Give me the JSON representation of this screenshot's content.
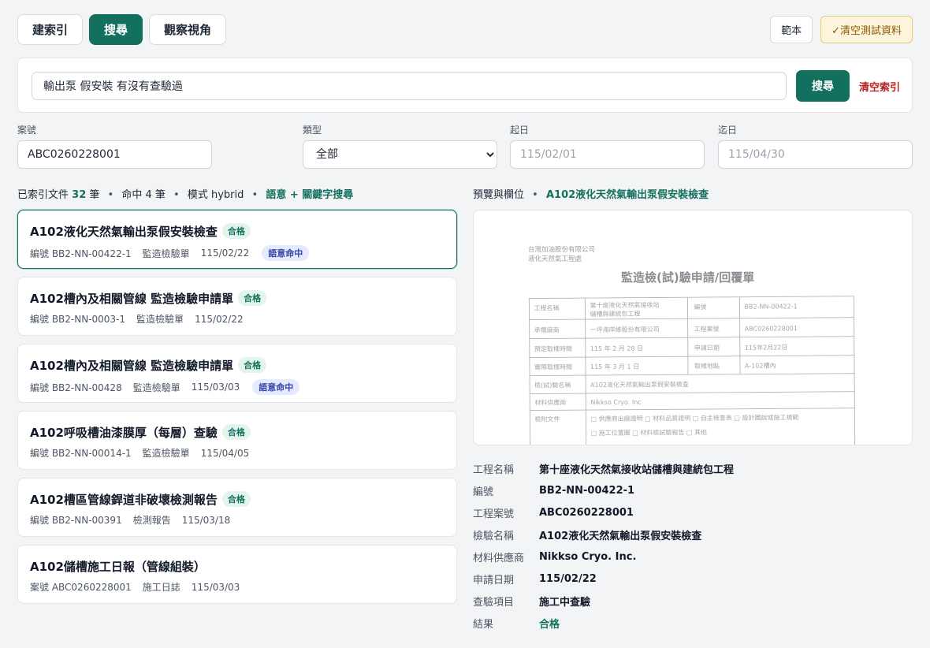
{
  "tabs": [
    {
      "label": "建索引"
    },
    {
      "label": "搜尋"
    },
    {
      "label": "觀察視角"
    }
  ],
  "top_buttons": {
    "sample": "範本",
    "clear_test": "✓清空測試資料"
  },
  "search": {
    "query": "輸出泵 假安裝 有沒有查驗過",
    "button": "搜尋",
    "clear_index": "清空索引"
  },
  "filters": {
    "case_no": {
      "label": "案號",
      "value": "ABC0260228001"
    },
    "type": {
      "label": "類型",
      "selected": "全部"
    },
    "start": {
      "label": "起日",
      "placeholder": "115/02/01"
    },
    "end": {
      "label": "迄日",
      "placeholder": "115/04/30"
    }
  },
  "summary": {
    "indexed_prefix": "已索引文件",
    "indexed_count": "32",
    "indexed_suffix": "筆",
    "dot": "•",
    "hits": "命中 4 筆",
    "mode": "模式 hybrid",
    "mode_label": "語意 + 關鍵字搜尋"
  },
  "results": [
    {
      "title": "A102液化天然氣輸出泵假安裝檢查",
      "badge": "合格",
      "id": "編號 BB2-NN-00422-1",
      "type": "監造檢驗單",
      "date": "115/02/22",
      "semantic": "語意命中"
    },
    {
      "title": "A102槽內及相關管線 監造檢驗申請單",
      "badge": "合格",
      "id": "編號 BB2-NN-0003-1",
      "type": "監造檢驗單",
      "date": "115/02/22",
      "semantic": ""
    },
    {
      "title": "A102槽內及相關管線 監造檢驗申請單",
      "badge": "合格",
      "id": "編號 BB2-NN-00428",
      "type": "監造檢驗單",
      "date": "115/03/03",
      "semantic": "語意命中"
    },
    {
      "title": "A102呼吸槽油漆膜厚（每層）查驗",
      "badge": "合格",
      "id": "編號 BB2-NN-00014-1",
      "type": "監造檢驗單",
      "date": "115/04/05",
      "semantic": ""
    },
    {
      "title": "A102槽區管線銲道非破壞檢測報告",
      "badge": "合格",
      "id": "編號 BB2-NN-00391",
      "type": "檢測報告",
      "date": "115/03/18",
      "semantic": ""
    },
    {
      "title": "A102儲槽施工日報（管線組裝）",
      "badge": "",
      "id": "案號 ABC0260228001",
      "type": "施工日誌",
      "date": "115/03/03",
      "semantic": ""
    }
  ],
  "preview": {
    "label": "預覽與欄位",
    "title": "A102液化天然氣輸出泵假安裝檢查",
    "doc": {
      "company_1": "台灣加油股份有限公司",
      "company_2": "液化天然氣工程處",
      "title": "監造檢(試)驗申請/回覆單",
      "rows": [
        [
          "工程名稱",
          "第十座液化天然氣接收站",
          "編號",
          "BB2-NN-00422-1"
        ],
        [
          "承攬廠商",
          "一坪海岸維股份有限公司",
          "工程案號",
          "ABC0260228001"
        ],
        [
          "預定取樣時間",
          "115 年 2 月 28 日",
          "申請日期",
          "115年2月22日"
        ],
        [
          "實際取樣時間",
          "115 年 3 月 1 日",
          "取樣地點",
          "A-102槽內"
        ],
        [
          "檢(試)驗名稱",
          "A102液化天然氣輸出泵假安裝檢查",
          "",
          ""
        ],
        [
          "材料供應商",
          "Nikkso Cryo. Inc",
          "",
          ""
        ],
        [
          "檢附文件",
          "□ 供應商出廠證明 □ 材料品質證明 □ 自主檢查表 □ 設計圖說或施工規範",
          "",
          ""
        ],
        [
          "",
          "□ 施工位置圖 □ 材料檢試驗報告 □ 其他",
          "",
          ""
        ]
      ],
      "row0_line2": "儲槽與建統包工程"
    },
    "fields": [
      {
        "k": "工程名稱",
        "v": "第十座液化天然氣接收站儲槽與建統包工程"
      },
      {
        "k": "編號",
        "v": "BB2-NN-00422-1"
      },
      {
        "k": "工程案號",
        "v": "ABC0260228001"
      },
      {
        "k": "檢驗名稱",
        "v": "A102液化天然氣輸出泵假安裝檢查"
      },
      {
        "k": "材料供應商",
        "v": "Nikkso Cryo. Inc."
      },
      {
        "k": "申請日期",
        "v": "115/02/22"
      },
      {
        "k": "查驗項目",
        "v": "施工中查驗"
      },
      {
        "k": "結果",
        "v": "合格"
      }
    ]
  }
}
